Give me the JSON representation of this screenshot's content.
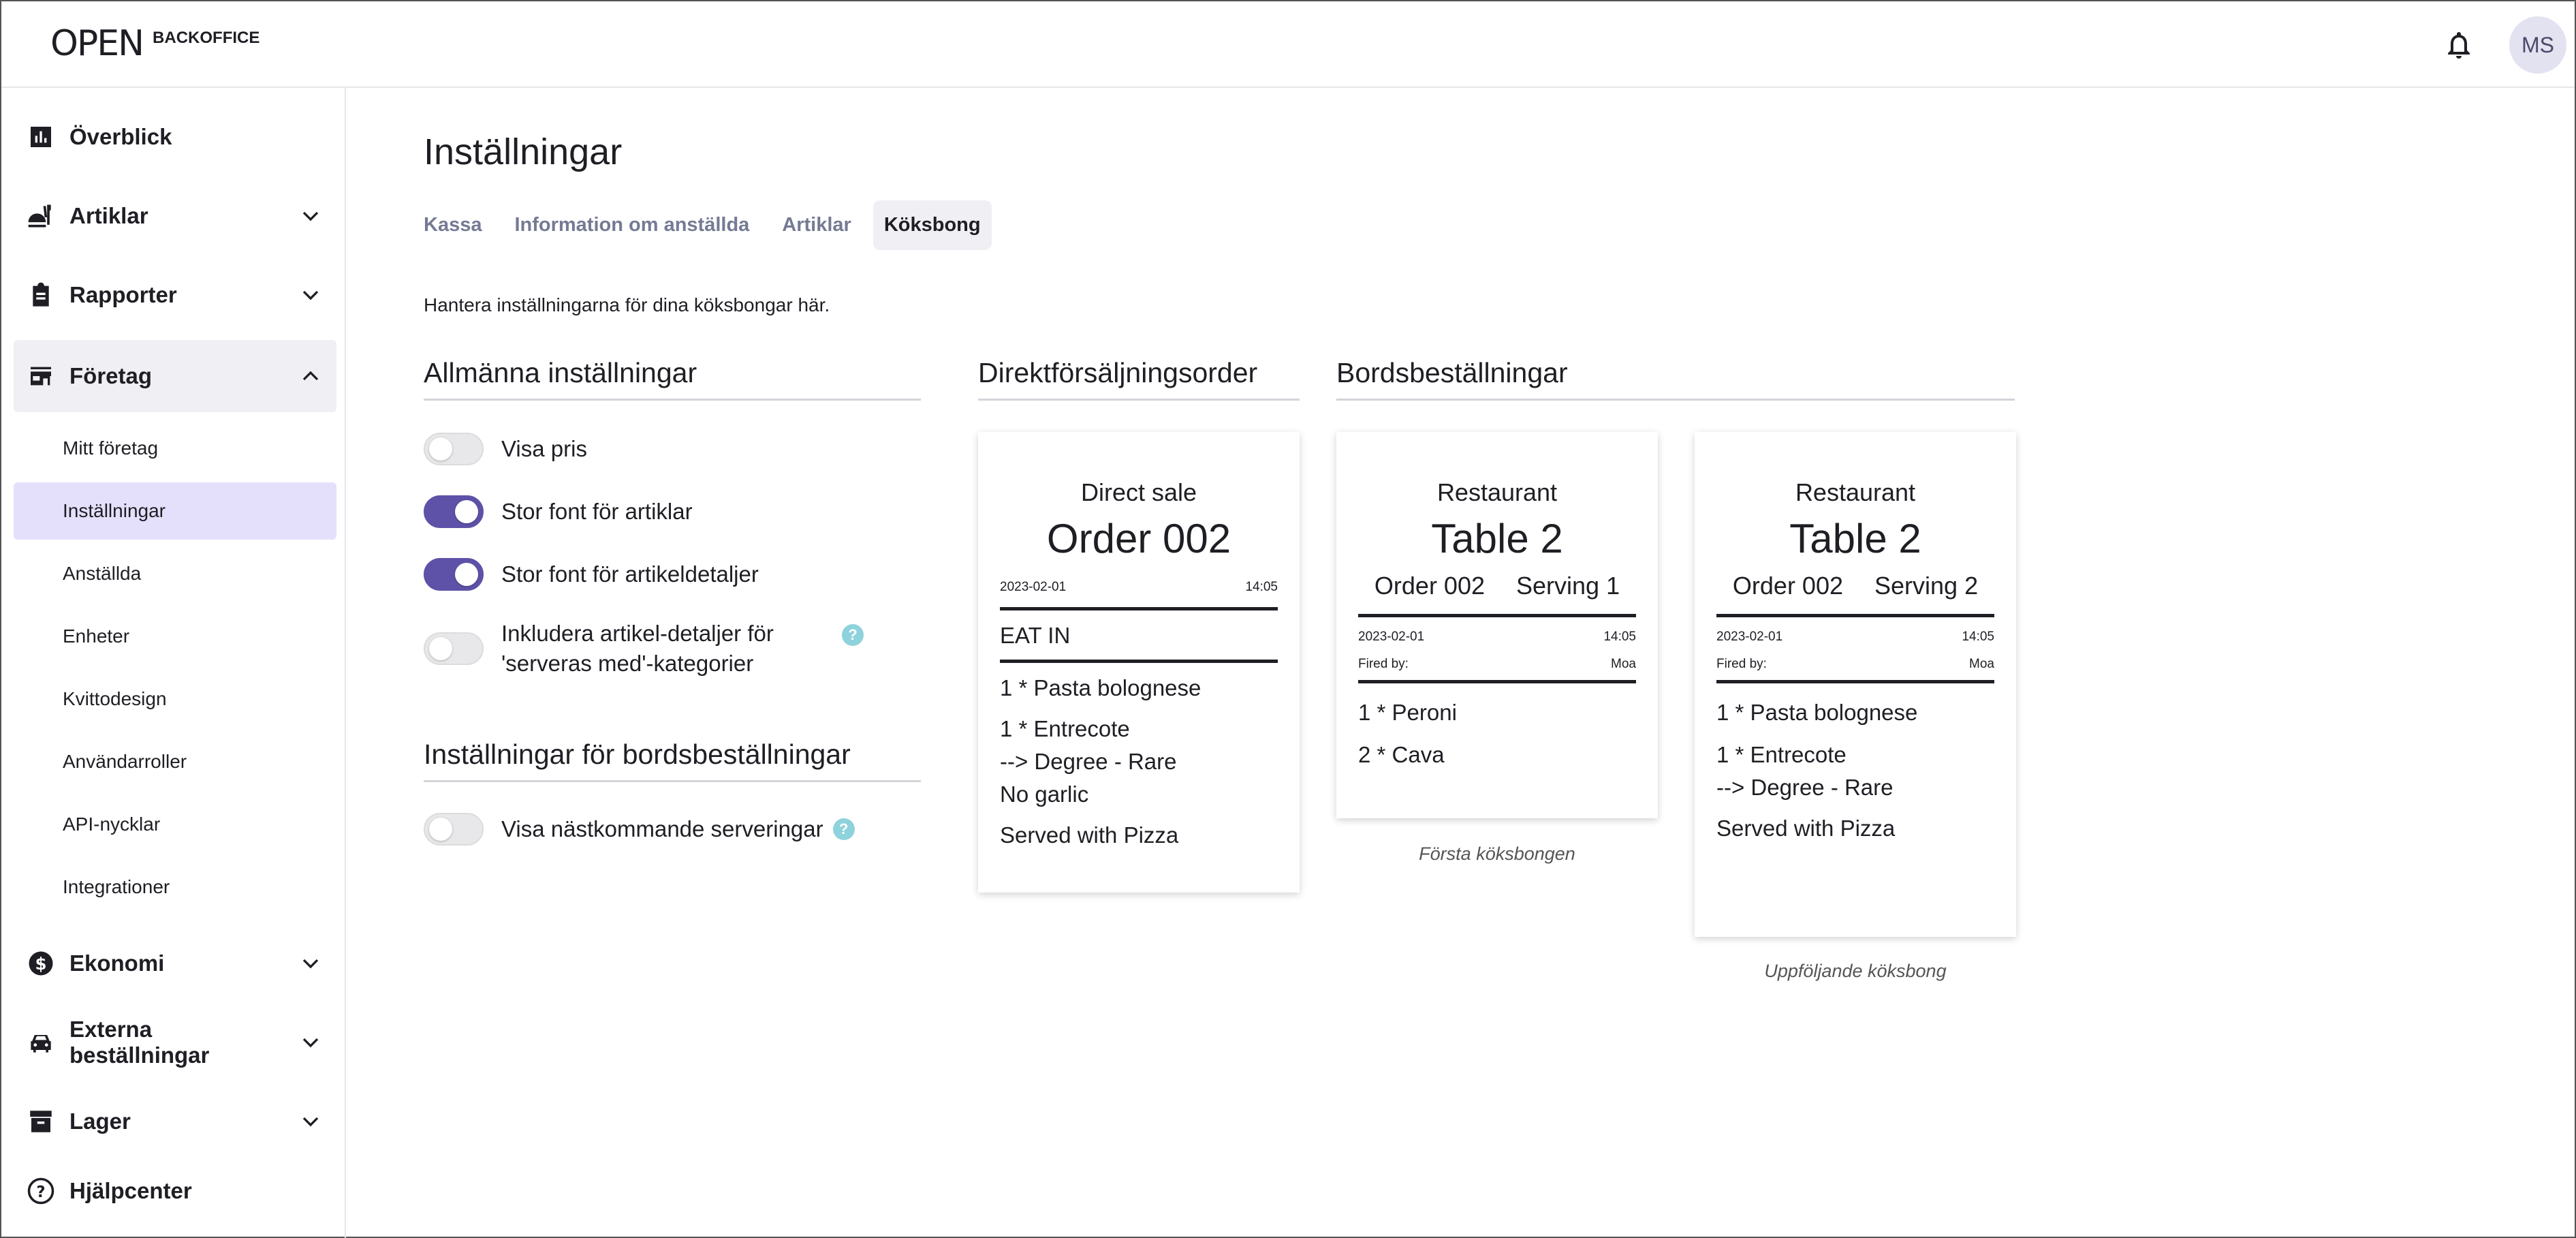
{
  "header": {
    "logo_word": "OPEN",
    "logo_product": "BACKOFFICE",
    "bell_icon": "bell-icon",
    "avatar_initials": "MS"
  },
  "sidebar": {
    "items": [
      {
        "label": "Överblick",
        "icon": "chart-icon"
      },
      {
        "label": "Artiklar",
        "icon": "food-icon"
      },
      {
        "label": "Rapporter",
        "icon": "clipboard-icon"
      },
      {
        "label": "Företag",
        "icon": "store-icon"
      },
      {
        "label": "Ekonomi",
        "icon": "dollar-icon"
      },
      {
        "label": "Externa beställningar",
        "icon": "car-icon"
      },
      {
        "label": "Lager",
        "icon": "archive-icon"
      },
      {
        "label": "Hjälpcenter",
        "icon": "help-circle-icon"
      }
    ],
    "foretag_sub": [
      "Mitt företag",
      "Inställningar",
      "Anställda",
      "Enheter",
      "Kvittodesign",
      "Användarroller",
      "API-nycklar",
      "Integrationer"
    ]
  },
  "page": {
    "title": "Inställningar",
    "tabs": [
      "Kassa",
      "Information om anställda",
      "Artiklar",
      "Köksbong"
    ],
    "active_tab": "Köksbong",
    "description": "Hantera inställningarna för dina köksbongar här."
  },
  "general": {
    "title": "Allmänna inställningar",
    "toggles": [
      {
        "label": "Visa pris",
        "on": false
      },
      {
        "label": "Stor font för artiklar",
        "on": true
      },
      {
        "label": "Stor font för artikeldetaljer",
        "on": true
      },
      {
        "label_line1": "Inkludera artikel-detaljer för",
        "label_line2": "'serveras med'-kategorier",
        "on": false,
        "help": "?"
      }
    ]
  },
  "table_settings": {
    "title": "Inställningar för bordsbeställningar",
    "toggle": {
      "label": "Visa nästkommande serveringar",
      "on": false,
      "help": "?"
    }
  },
  "direct": {
    "title": "Direktförsäljningsorder",
    "card": {
      "heading": "Direct sale",
      "order": "Order 002",
      "date": "2023-02-01",
      "time": "14:05",
      "mode": "EAT IN",
      "lines": [
        "1 * Pasta bolognese",
        "1 * Entrecote",
        "--> Degree - Rare",
        "No garlic",
        "Served with Pizza"
      ]
    }
  },
  "table_orders": {
    "title": "Bordsbeställningar",
    "cards": [
      {
        "heading": "Restaurant",
        "table": "Table 2",
        "order": "Order 002",
        "serving": "Serving 1",
        "date": "2023-02-01",
        "time": "14:05",
        "fired_label": "Fired by:",
        "fired_by": "Moa",
        "lines": [
          "1 * Peroni",
          "2 * Cava"
        ],
        "caption": "Första köksbongen"
      },
      {
        "heading": "Restaurant",
        "table": "Table 2",
        "order": "Order 002",
        "serving": "Serving 2",
        "date": "2023-02-01",
        "time": "14:05",
        "fired_label": "Fired by:",
        "fired_by": "Moa",
        "lines": [
          "1 * Pasta bolognese",
          "1 * Entrecote",
          "--> Degree - Rare",
          "Served with Pizza"
        ],
        "caption": "Uppföljande köksbong"
      }
    ]
  },
  "colors": {
    "accent": "#5d52a8",
    "active_sub_bg": "#e4e0fb",
    "help": "#8ed2dc"
  }
}
